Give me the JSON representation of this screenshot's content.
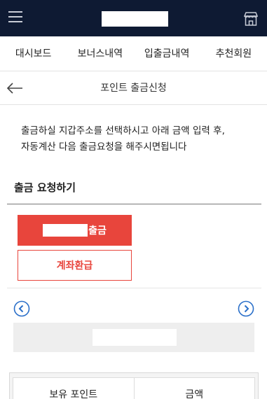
{
  "nav": {
    "items": [
      {
        "label": "대시보드"
      },
      {
        "label": "보너스내역"
      },
      {
        "label": "입출금내역"
      },
      {
        "label": "추천회원"
      }
    ]
  },
  "page": {
    "title": "포인트 출금신청"
  },
  "intro": {
    "line1": "출금하실 지갑주소를 선택하시고 아래 금액 입력 후,",
    "line2": "자동계산 다음 출금요청을 해주시면됩니다"
  },
  "section": {
    "title": "출금 요청하기"
  },
  "buttons": {
    "withdraw_label": "출금",
    "refund_label": "계좌환급"
  },
  "table": {
    "headers": [
      "보유 포인트",
      "금액"
    ]
  },
  "colors": {
    "topbar": "#0e1a33",
    "accent": "#e8453c",
    "arrow": "#2a6fc9"
  }
}
